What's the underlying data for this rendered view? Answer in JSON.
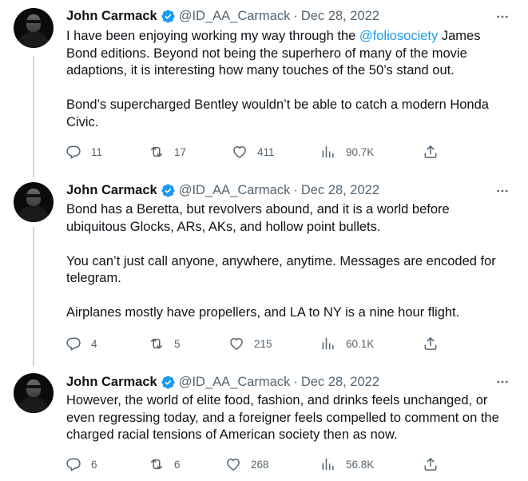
{
  "tweets": [
    {
      "author": {
        "name": "John Carmack",
        "handle": "@ID_AA_Carmack",
        "separator": "·",
        "date": "Dec 28, 2022"
      },
      "lines": [
        {
          "parts": [
            {
              "t": "I have been enjoying working my way through the "
            },
            {
              "t": "@foliosociety",
              "mention": true
            },
            {
              "t": " James"
            }
          ]
        },
        {
          "parts": [
            {
              "t": "Bond editions. Beyond not being the superhero of many of the movie"
            }
          ]
        },
        {
          "parts": [
            {
              "t": "adaptions, it is interesting how many touches of the 50’s stand out."
            }
          ]
        },
        {
          "gap": true
        },
        {
          "parts": [
            {
              "t": "Bond’s supercharged Bentley wouldn’t be able to catch a modern Honda"
            }
          ]
        },
        {
          "parts": [
            {
              "t": "Civic."
            }
          ]
        }
      ],
      "stats": {
        "replies": "11",
        "retweets": "17",
        "likes": "411",
        "views": "90.7K"
      }
    },
    {
      "author": {
        "name": "John Carmack",
        "handle": "@ID_AA_Carmack",
        "separator": "·",
        "date": "Dec 28, 2022"
      },
      "lines": [
        {
          "parts": [
            {
              "t": "Bond has a Beretta, but revolvers abound, and it is a world before"
            }
          ]
        },
        {
          "parts": [
            {
              "t": "ubiquitous Glocks, ARs, AKs, and hollow point bullets."
            }
          ]
        },
        {
          "gap": true
        },
        {
          "parts": [
            {
              "t": "You can’t just call anyone, anywhere, anytime. Messages are encoded for"
            }
          ]
        },
        {
          "parts": [
            {
              "t": "telegram."
            }
          ]
        },
        {
          "gap": true
        },
        {
          "parts": [
            {
              "t": "Airplanes mostly have propellers, and LA to NY is a nine hour flight."
            }
          ]
        }
      ],
      "stats": {
        "replies": "4",
        "retweets": "5",
        "likes": "215",
        "views": "60.1K"
      }
    },
    {
      "author": {
        "name": "John Carmack",
        "handle": "@ID_AA_Carmack",
        "separator": "·",
        "date": "Dec 28, 2022"
      },
      "lines": [
        {
          "parts": [
            {
              "t": "However, the world of elite food, fashion, and drinks feels unchanged, or"
            }
          ]
        },
        {
          "parts": [
            {
              "t": "even regressing today, and a foreigner feels compelled to comment on the"
            }
          ]
        },
        {
          "parts": [
            {
              "t": "charged racial tensions of American society then as now."
            }
          ]
        }
      ],
      "stats": {
        "replies": "6",
        "retweets": "6",
        "likes": "268",
        "views": "56.8K"
      }
    }
  ],
  "colors": {
    "text": "#0f1419",
    "secondary": "#536471",
    "link": "#1d9bf0",
    "verified": "#1d9bf0",
    "thread": "#cfd9de"
  },
  "icons": {
    "reply": "reply-icon",
    "retweet": "retweet-icon",
    "like": "like-icon",
    "views": "views-icon",
    "share": "share-icon",
    "more": "more-icon",
    "verified": "verified-badge-icon"
  }
}
